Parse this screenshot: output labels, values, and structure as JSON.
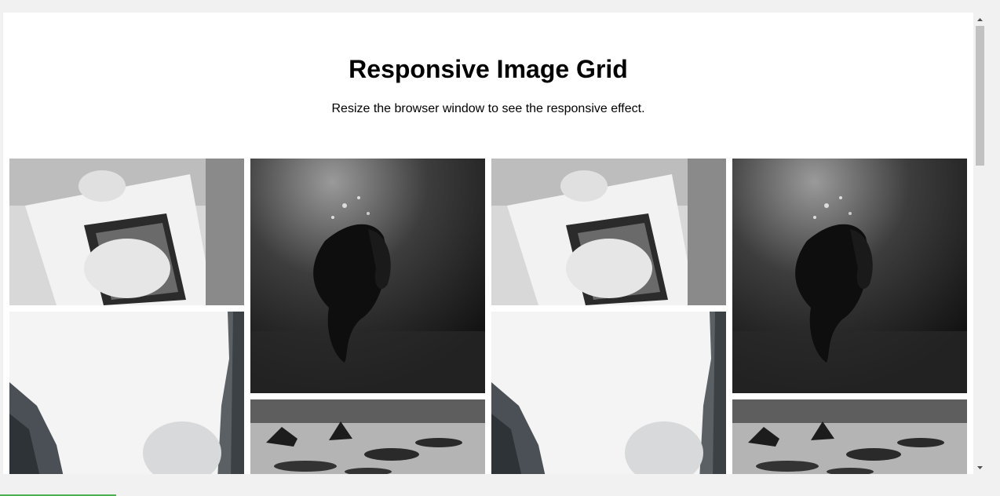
{
  "page": {
    "title": "Responsive Image Grid",
    "subtitle": "Resize the browser window to see the responsive effect."
  },
  "images": [
    {
      "name": "wedding-car-image",
      "icon": "photo"
    },
    {
      "name": "underwater-person-image",
      "icon": "photo"
    },
    {
      "name": "foggy-cliffs-image",
      "icon": "photo"
    },
    {
      "name": "rocky-beach-image",
      "icon": "photo"
    }
  ],
  "colors": {
    "background": "#ffffff",
    "scrollbar_track": "#f1f1f1",
    "scrollbar_thumb": "#c1c1c1",
    "accent_strip": "#4caf50"
  }
}
